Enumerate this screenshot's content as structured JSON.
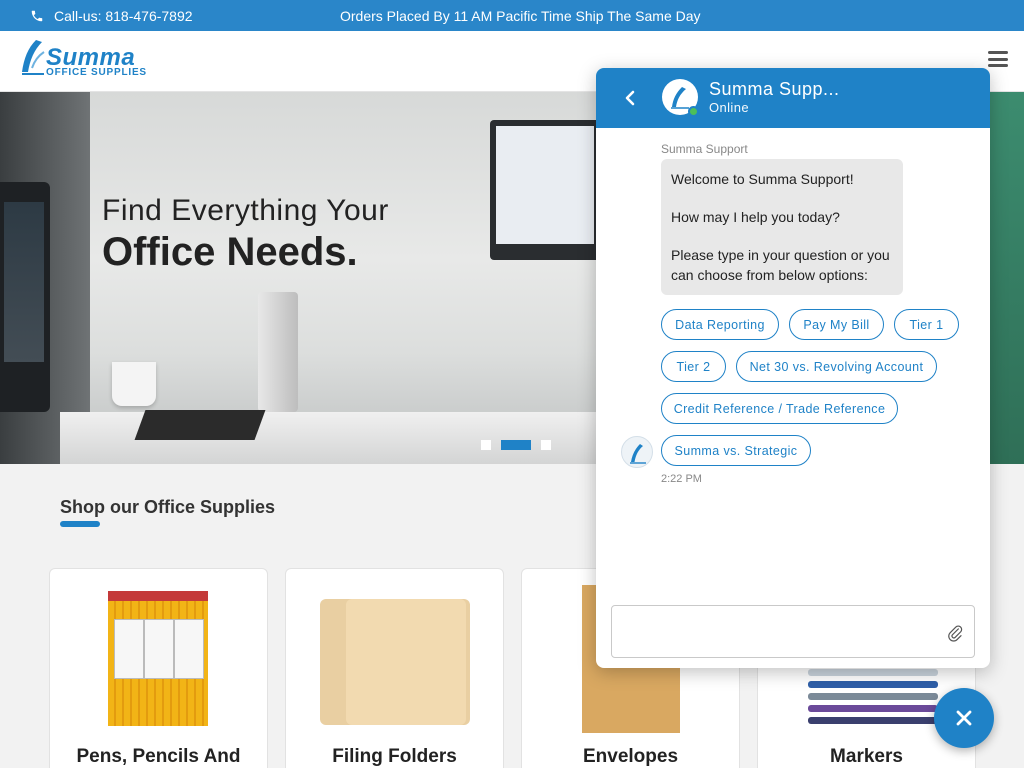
{
  "topbar": {
    "phone_text": "Call-us: 818-476-7892",
    "promo_text": "Orders Placed By 11 AM Pacific Time Ship The Same Day"
  },
  "header": {
    "logo_word": "Summa",
    "logo_sub": "OFFICE SUPPLIES"
  },
  "hero": {
    "title_line1": "Find Everything Your",
    "title_line2": "Office Needs.",
    "slide_count": 3,
    "active_slide": 2
  },
  "shop": {
    "title": "Shop our Office Supplies",
    "cards": [
      {
        "label": "Pens, Pencils And"
      },
      {
        "label": "Filing Folders"
      },
      {
        "label": "Envelopes"
      },
      {
        "label": "Markers"
      }
    ]
  },
  "chat": {
    "agent_name": "Summa Supp...",
    "status": "Online",
    "sender_label": "Summa Support",
    "message": [
      "Welcome to Summa Support!",
      "How may I help you today?",
      "Please type in your question or you can choose from below options:"
    ],
    "options": [
      "Data Reporting",
      "Pay My Bill",
      "Tier 1",
      "Tier 2",
      "Net 30 vs. Revolving Account",
      "Credit Reference / Trade Reference",
      "Summa vs. Strategic"
    ],
    "timestamp": "2:22 PM",
    "input_placeholder": ""
  },
  "colors": {
    "brand_blue": "#1f82c7",
    "topbar_blue": "#2a86c9",
    "online_green": "#4cbf5a"
  },
  "icons": [
    "phone-icon",
    "hamburger-menu-icon",
    "back-arrow-icon",
    "paperclip-icon",
    "close-icon"
  ]
}
